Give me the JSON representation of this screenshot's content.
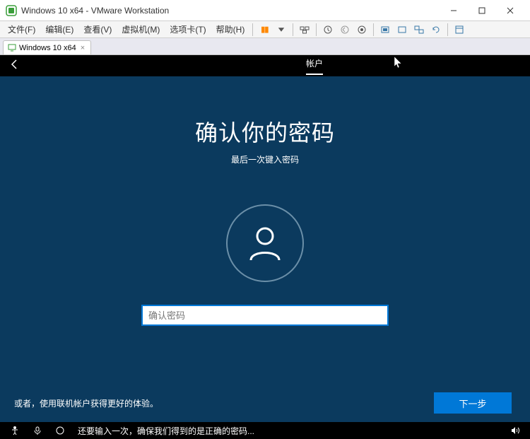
{
  "window": {
    "title": "Windows 10 x64 - VMware Workstation"
  },
  "menu": {
    "file": "文件(F)",
    "edit": "编辑(E)",
    "view": "查看(V)",
    "vm": "虚拟机(M)",
    "tabs": "选项卡(T)",
    "help": "帮助(H)"
  },
  "tab": {
    "label": "Windows 10 x64"
  },
  "oobe": {
    "tab_label": "帐户",
    "title": "确认你的密码",
    "subtitle": "最后一次键入密码",
    "placeholder": "确认密码",
    "link": "或者，使用联机帐户获得更好的体验。",
    "next": "下一步",
    "bottom_text": "还要输入一次，确保我们得到的是正确的密码..."
  }
}
